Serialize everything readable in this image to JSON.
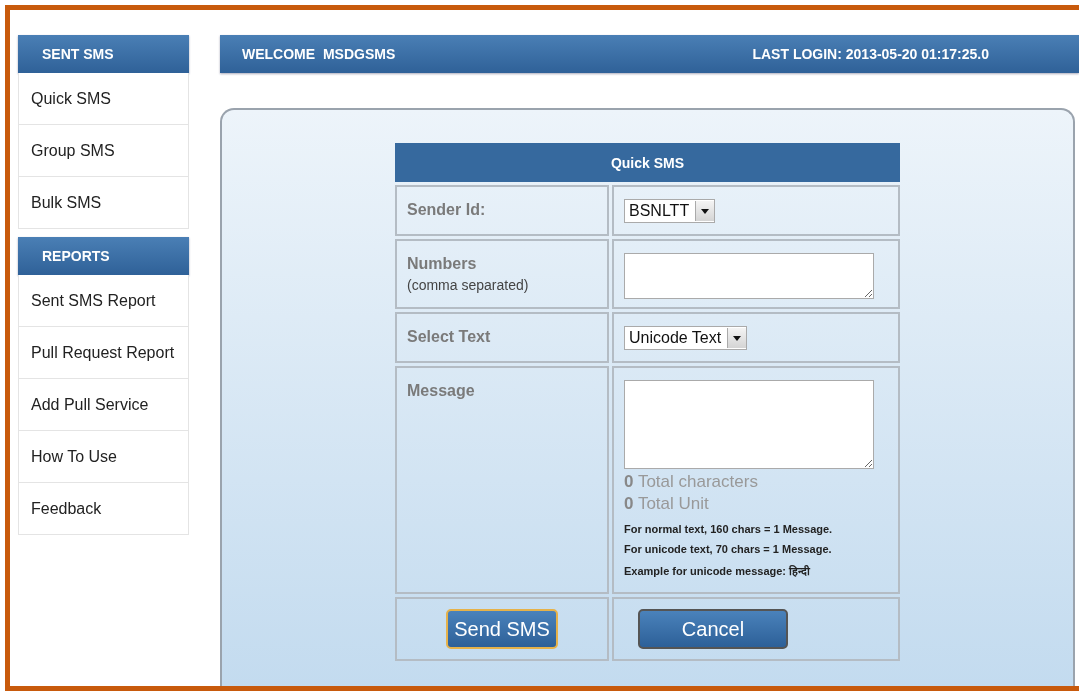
{
  "sidebar": [
    {
      "heading": "SENT SMS",
      "items": [
        {
          "label": "Quick SMS"
        },
        {
          "label": "Group SMS"
        },
        {
          "label": "Bulk SMS"
        }
      ]
    },
    {
      "heading": "REPORTS",
      "items": [
        {
          "label": "Sent SMS Report"
        },
        {
          "label": "Pull Request Report"
        },
        {
          "label": "Add Pull Service"
        },
        {
          "label": "How To Use"
        },
        {
          "label": "Feedback"
        }
      ]
    }
  ],
  "header": {
    "welcome": "WELCOME  MSDGSMS",
    "last_login": "LAST LOGIN: 2013-05-20 01:17:25.0"
  },
  "form": {
    "title": "Quick SMS",
    "rows": [
      {
        "kind": "select",
        "label": "Sender Id:",
        "value": "BSNLTT"
      },
      {
        "kind": "textarea",
        "label": "Numbers",
        "hint": "(comma separated)"
      },
      {
        "kind": "select",
        "label": "Select Text",
        "value": "Unicode Text"
      },
      {
        "kind": "message",
        "label": "Message",
        "counters": [
          "**0** Total characters",
          "**0** Total Unit"
        ],
        "notes": [
          "For normal text, 160 chars = 1 Message.",
          "For unicode text, 70 chars = 1 Message.",
          "Example for unicode message: हिन्दी"
        ]
      }
    ],
    "buttons": [
      {
        "label": "Send SMS",
        "focused": true
      },
      {
        "label": "Cancel",
        "focused": false
      }
    ]
  }
}
